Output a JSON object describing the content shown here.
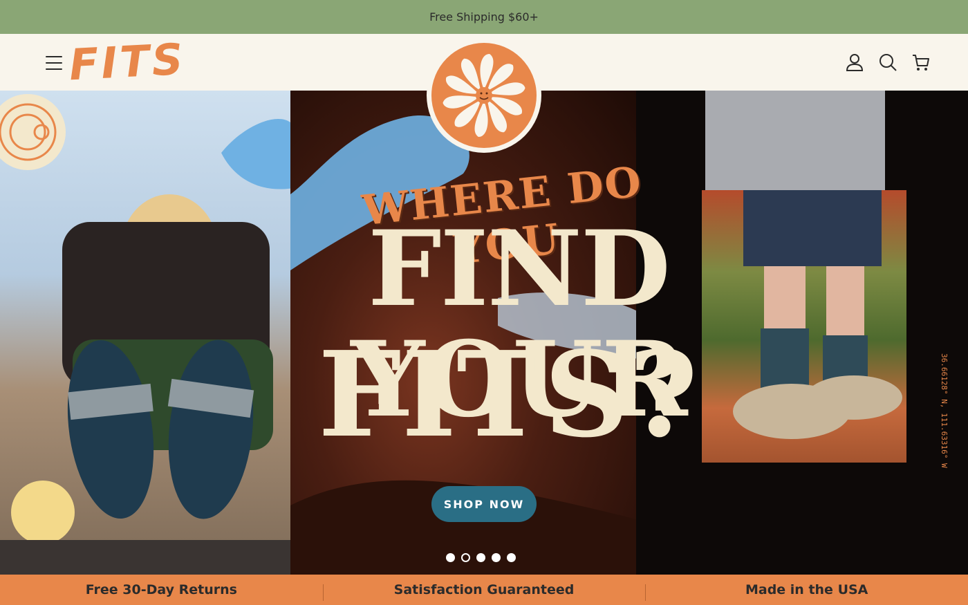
{
  "announcement": {
    "text": "Free Shipping $60+"
  },
  "header": {
    "logo_text": "FITS",
    "icons": [
      "menu-icon",
      "account-icon",
      "search-icon",
      "cart-icon"
    ]
  },
  "hero": {
    "headline_small": "WHERE DO YOU",
    "headline_line1": "FIND YOUR",
    "headline_line2": "FITS?",
    "cta_label": "SHOP NOW",
    "coordinates": "36.66128° N, 111.63316° W",
    "carousel": {
      "slide_count": 5,
      "active_index": 1
    }
  },
  "features": [
    {
      "label": "Free 30-Day Returns"
    },
    {
      "label": "Satisfaction Guaranteed"
    },
    {
      "label": "Made in the USA"
    }
  ],
  "colors": {
    "accent_orange": "#e8874a",
    "announce_green": "#8aa675",
    "cta_teal": "#2a6e85",
    "cream": "#f9f5ec"
  }
}
